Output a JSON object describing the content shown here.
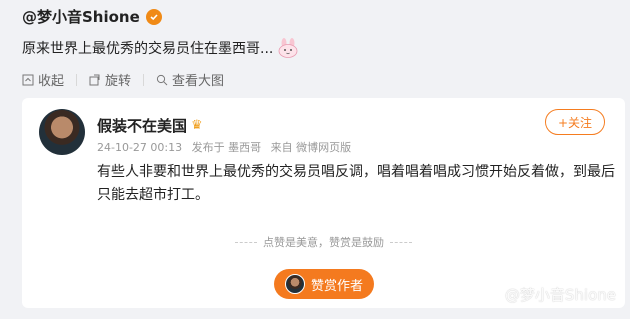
{
  "post": {
    "author": "@梦小音Shione",
    "text": "原来世界上最优秀的交易员住在墨西哥...",
    "tools": {
      "collapse": "收起",
      "rotate": "旋转",
      "view_large": "查看大图"
    }
  },
  "card": {
    "user_name": "假装不在美国",
    "meta": {
      "time": "24-10-27 00:13",
      "location": "发布于 墨西哥",
      "source": "来自 微博网页版"
    },
    "follow_label": "+关注",
    "body": "有些人非要和世界上最优秀的交易员唱反调，唱着唱着唱成习惯开始反着做，到最后只能去超市打工。",
    "reward_hint": "点赞是美意，赞赏是鼓励",
    "reward_button": "赞赏作者"
  },
  "watermark": "@梦小音Shione",
  "colors": {
    "accent": "#f47a1f",
    "verified": "#f08a16",
    "page_bg": "#f1f2f5"
  }
}
